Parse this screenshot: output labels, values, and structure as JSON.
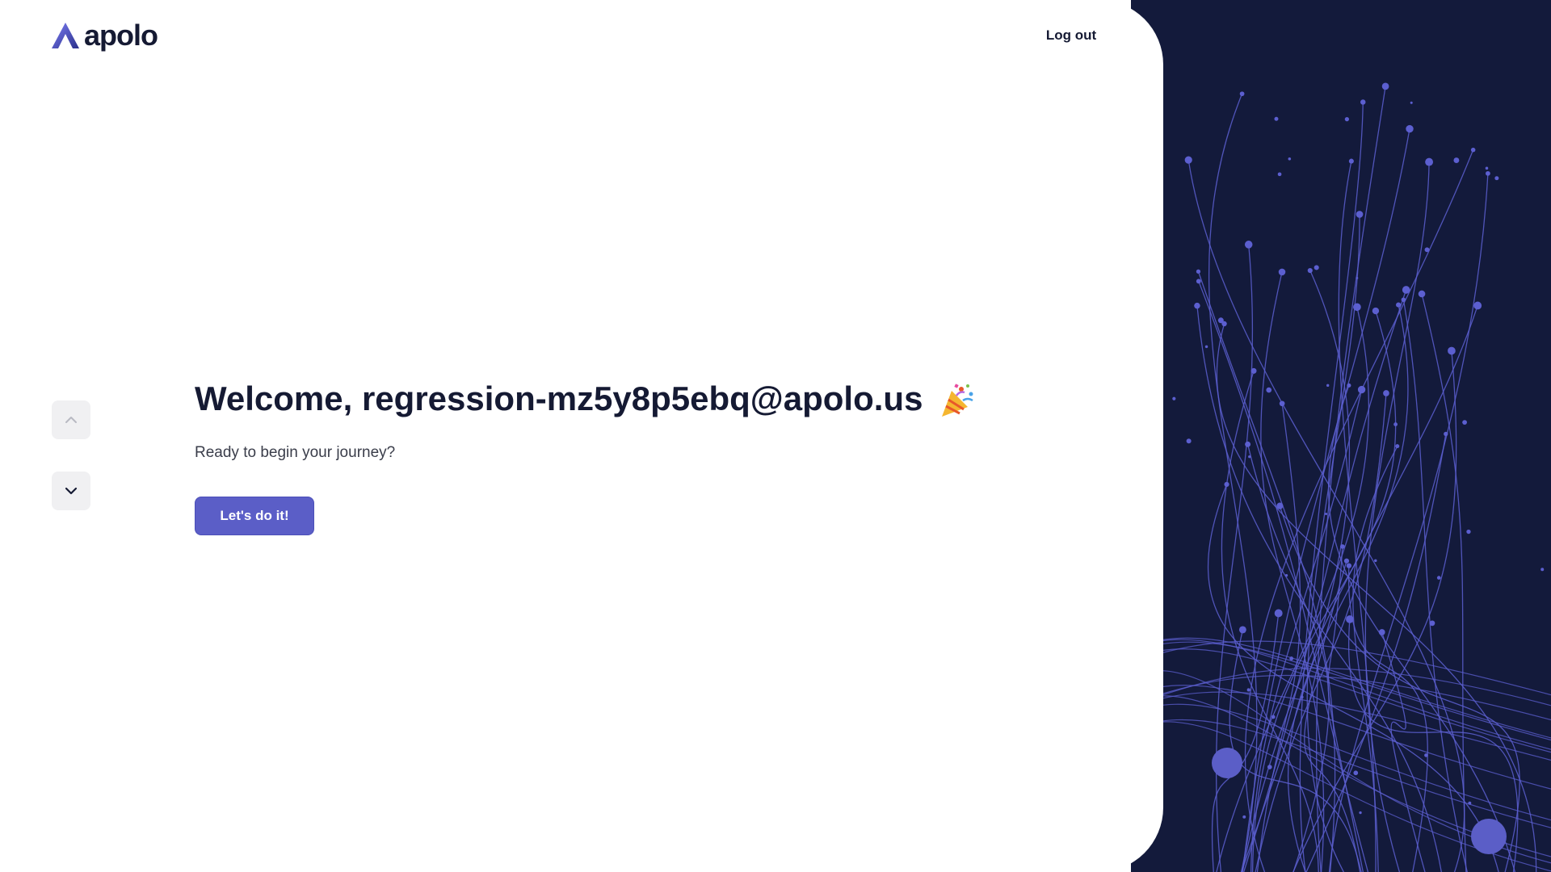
{
  "brand": {
    "name": "apolo",
    "logo_icon": "apolo-logo-icon",
    "logo_gradient": [
      "#6a6cf0",
      "#2a2f8a"
    ]
  },
  "header": {
    "logout_label": "Log out"
  },
  "navigation": {
    "up_icon": "chevron-up-icon",
    "down_icon": "chevron-down-icon"
  },
  "main": {
    "heading": "Welcome, regression-mz5y8p5ebq@apolo.us",
    "heading_icon": "party-popper-icon",
    "subtitle": "Ready to begin your journey?",
    "cta_label": "Let's do it!"
  },
  "theme": {
    "accent": "#5b5ec7",
    "panel_bg": "#131a3b",
    "line_color": "#5c5fd0",
    "text_dark": "#151a33"
  }
}
